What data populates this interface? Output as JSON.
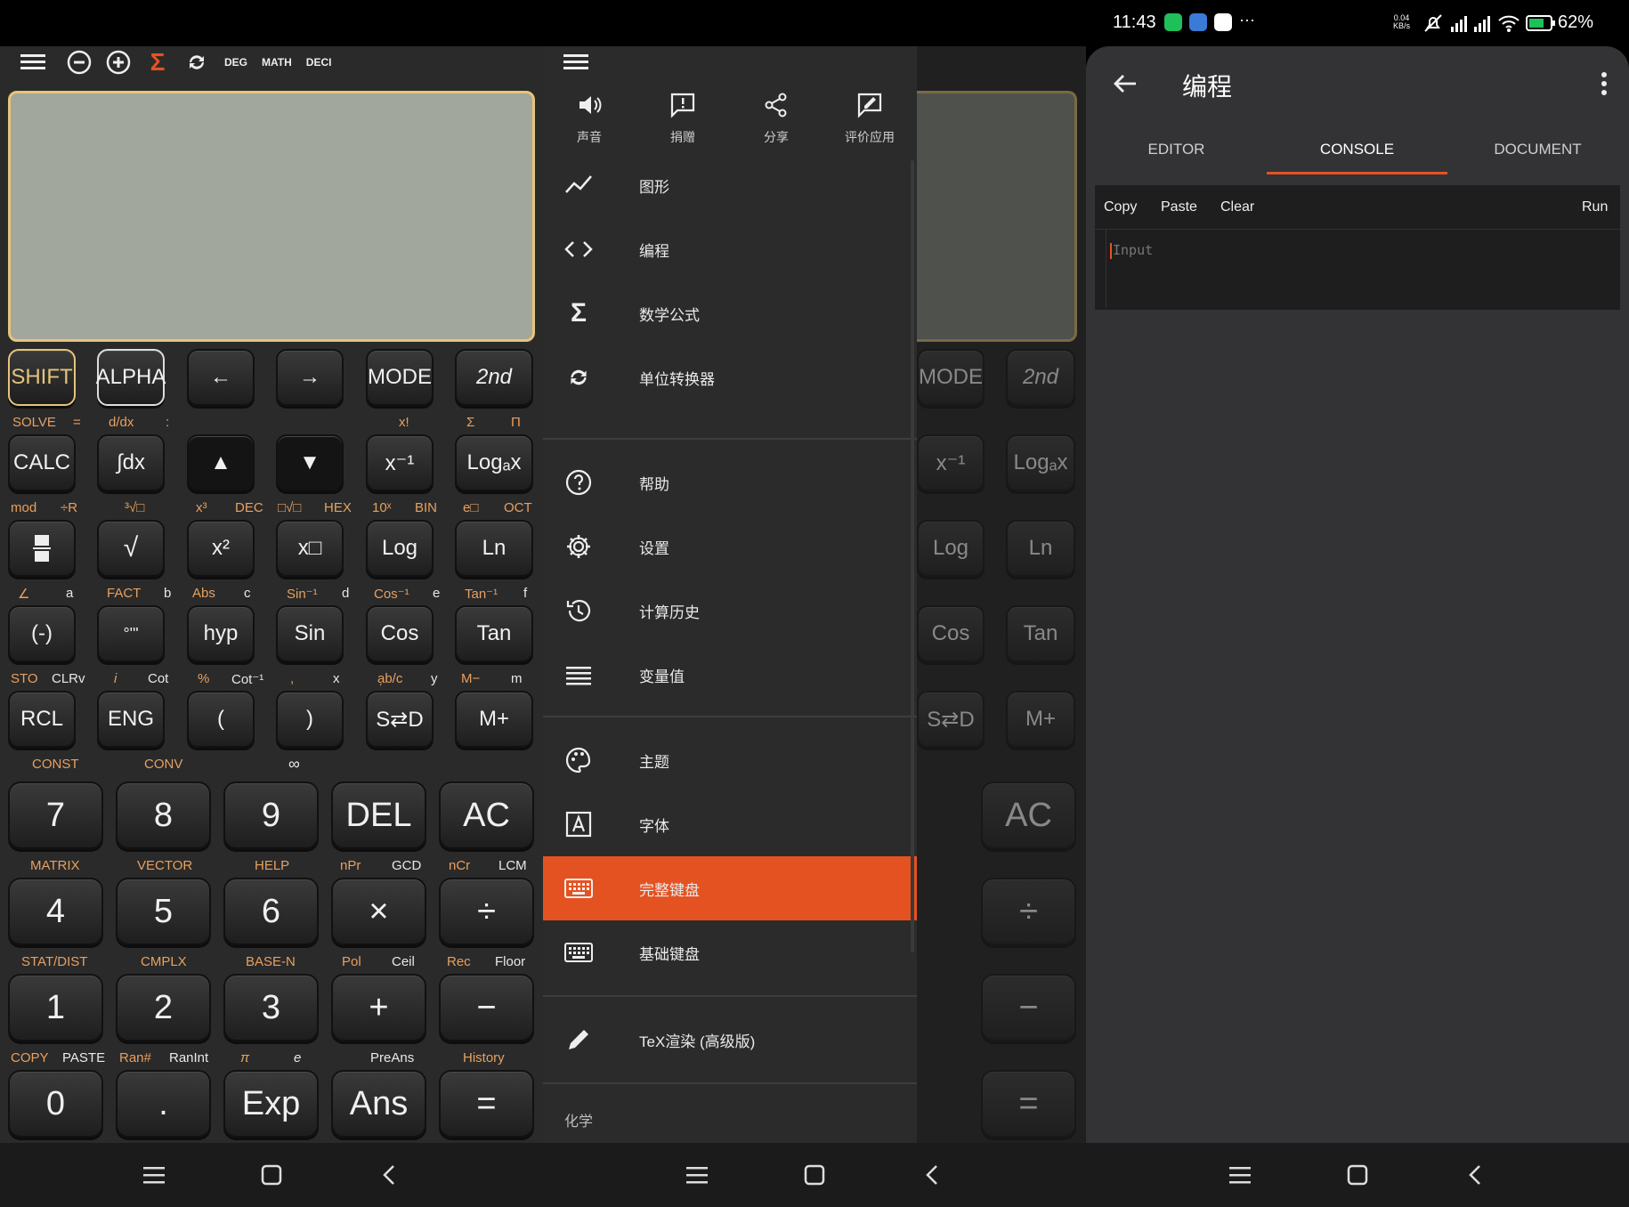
{
  "status_bar": {
    "time": "11:43",
    "net_speed": "0.04",
    "net_unit": "KB/s",
    "battery": "62%"
  },
  "calc": {
    "topbar": {
      "deg": "DEG",
      "math": "MATH",
      "deci": "DECI"
    },
    "row1": {
      "shift": "SHIFT",
      "alpha": "ALPHA",
      "mode": "MODE",
      "second": "2nd"
    },
    "row1_labels": {
      "solve": "SOLVE",
      "eq": "=",
      "ddx": "d/dx",
      "colon": ":",
      "fact_excl": "x!",
      "sigma": "Σ",
      "pi_prod": "Π"
    },
    "row2": {
      "calc": "CALC",
      "intdx": "∫dx",
      "up": "▲",
      "down": "▼",
      "xinv": "x⁻¹",
      "logax": "Logₐx"
    },
    "row2_labels": {
      "mod": "mod",
      "divr": "÷R",
      "cuberoot": "³√□",
      "x3": "x³",
      "dec": "DEC",
      "nroot": "□√□",
      "hex": "HEX",
      "tenx": "10ˣ",
      "bin": "BIN",
      "ebox": "e□",
      "oct": "OCT"
    },
    "row3": {
      "sqrt": "√",
      "x2": "x²",
      "xbox": "x□",
      "log": "Log",
      "ln": "Ln"
    },
    "row3_labels": {
      "angle": "∠",
      "a": "a",
      "fact": "FACT",
      "b": "b",
      "abs": "Abs",
      "c": "c",
      "sininv": "Sin⁻¹",
      "d": "d",
      "cosinv": "Cos⁻¹",
      "e": "e",
      "taninv": "Tan⁻¹",
      "f": "f"
    },
    "row4": {
      "neg": "(-)",
      "dms": "°'\"",
      "hyp": "hyp",
      "sin": "Sin",
      "cos": "Cos",
      "tan": "Tan"
    },
    "row4_labels": {
      "sto": "STO",
      "clrv": "CLRv",
      "i": "i",
      "cot": "Cot",
      "pct": "%",
      "cotinv": "Cot⁻¹",
      "comma": ",",
      "x": "x",
      "abc": "a᷊b/c",
      "y": "y",
      "mminus": "M−",
      "m": "m"
    },
    "row5": {
      "rcl": "RCL",
      "eng": "ENG",
      "lparen": "(",
      "rparen": ")",
      "sd": "S⇄D",
      "mplus": "M+"
    },
    "row5_labels": {
      "const": "CONST",
      "conv": "CONV",
      "inf": "∞"
    },
    "row6": {
      "k7": "7",
      "k8": "8",
      "k9": "9",
      "del": "DEL",
      "ac": "AC"
    },
    "row6_labels": {
      "matrix": "MATRIX",
      "vector": "VECTOR",
      "help": "HELP",
      "npr": "nPr",
      "gcd": "GCD",
      "ncr": "nCr",
      "lcm": "LCM"
    },
    "row7": {
      "k4": "4",
      "k5": "5",
      "k6": "6",
      "mul": "×",
      "div": "÷"
    },
    "row7_labels": {
      "stat": "STAT/DIST",
      "cmplx": "CMPLX",
      "basen": "BASE-N",
      "pol": "Pol",
      "ceil": "Ceil",
      "rec": "Rec",
      "floor": "Floor"
    },
    "row8": {
      "k1": "1",
      "k2": "2",
      "k3": "3",
      "plus": "+",
      "minus": "−"
    },
    "row8_labels": {
      "copy": "COPY",
      "paste": "PASTE",
      "ran": "Ran#",
      "ranint": "RanInt",
      "pi": "π",
      "e": "e",
      "preans": "PreAns",
      "history": "History"
    },
    "row9": {
      "k0": "0",
      "dot": ".",
      "exp": "Exp",
      "ans": "Ans",
      "eq": "="
    }
  },
  "drawer": {
    "top_actions": [
      {
        "icon": "volume-icon",
        "label": "声音"
      },
      {
        "icon": "donate-icon",
        "label": "捐赠"
      },
      {
        "icon": "share-icon",
        "label": "分享"
      },
      {
        "icon": "rate-icon",
        "label": "评价应用"
      }
    ],
    "items": [
      {
        "icon": "graph-icon",
        "label": "图形"
      },
      {
        "icon": "code-icon",
        "label": "编程"
      },
      {
        "icon": "sigma-icon",
        "label": "数学公式"
      },
      {
        "icon": "convert-icon",
        "label": "单位转换器"
      },
      {
        "icon": "help-icon",
        "label": "帮助"
      },
      {
        "icon": "settings-icon",
        "label": "设置"
      },
      {
        "icon": "history-icon",
        "label": "计算历史"
      },
      {
        "icon": "variables-icon",
        "label": "变量值"
      },
      {
        "icon": "palette-icon",
        "label": "主题"
      },
      {
        "icon": "font-icon",
        "label": "字体"
      },
      {
        "icon": "keyboard-icon",
        "label": "完整键盘"
      },
      {
        "icon": "keyboard-icon",
        "label": "基础键盘"
      },
      {
        "icon": "pencil-icon",
        "label": "TeX渲染 (高级版)"
      }
    ],
    "section_chem": "化学",
    "active_index": 10,
    "accent": "#e55221"
  },
  "console": {
    "title": "编程",
    "tabs": [
      "EDITOR",
      "CONSOLE",
      "DOCUMENT"
    ],
    "active_tab": 1,
    "toolbar": {
      "copy": "Copy",
      "paste": "Paste",
      "clear": "Clear",
      "run": "Run"
    },
    "input_placeholder": "Input"
  }
}
